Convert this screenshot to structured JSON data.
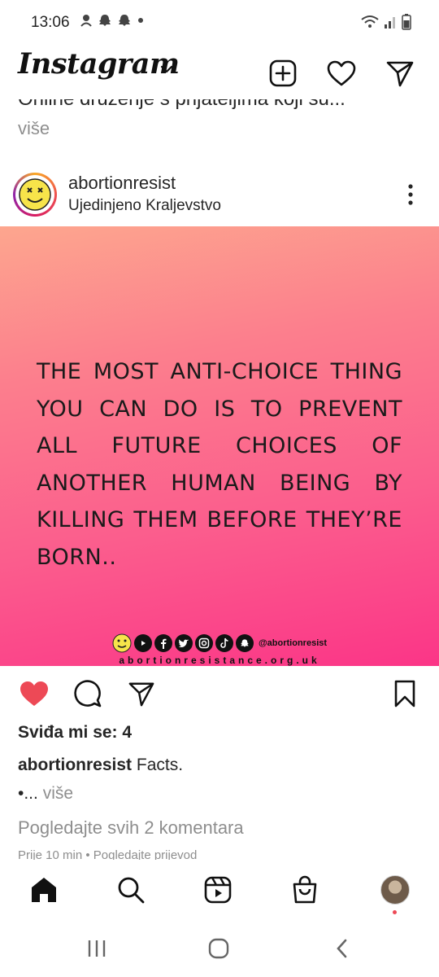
{
  "status_bar": {
    "time": "13:06",
    "left_icons": [
      "sync-icon",
      "snapchat-icon",
      "snapchat-icon",
      "dot-icon"
    ],
    "right_icons": [
      "wifi-icon",
      "signal-icon",
      "battery-icon"
    ]
  },
  "header": {
    "logo_text": "Instagram",
    "buttons": [
      "new-post-icon",
      "heart-icon",
      "direct-message-icon"
    ]
  },
  "previous_post": {
    "caption_partial": "Online druženje s prijateljima koji su...",
    "more_label": "više"
  },
  "post": {
    "username": "abortionresist",
    "location": "Ujedinjeno Kraljevstvo",
    "image_text": "The most anti-choice thing you can do is to prevent all future choices of another human being by killing them before they’re born..",
    "footer_handle": "@abortionresist",
    "footer_url": "abortionresistance.org.uk",
    "footer_icons": [
      "smiley-icon",
      "youtube-icon",
      "facebook-icon",
      "twitter-icon",
      "instagram-icon",
      "tiktok-icon",
      "snapchat-icon"
    ],
    "liked": true,
    "likes_text": "Sviđa mi se: 4",
    "caption_user": "abortionresist",
    "caption_text": " Facts.",
    "caption_more_prefix": "•...",
    "caption_more_label": " više",
    "comments_link": "Pogledajte svih 2 komentara",
    "meta_text": "Prije 10 min • Pogledajte prijevod"
  },
  "colors": {
    "like_red": "#ed4956",
    "muted_gray": "#8e8e8e",
    "gradient_top": "#fda68e",
    "gradient_bottom": "#fb3587"
  },
  "bottom_nav": [
    "home-icon",
    "search-icon",
    "reels-icon",
    "shop-icon",
    "profile-avatar"
  ],
  "system_nav": [
    "recents-icon",
    "home-circle-icon",
    "back-icon"
  ]
}
